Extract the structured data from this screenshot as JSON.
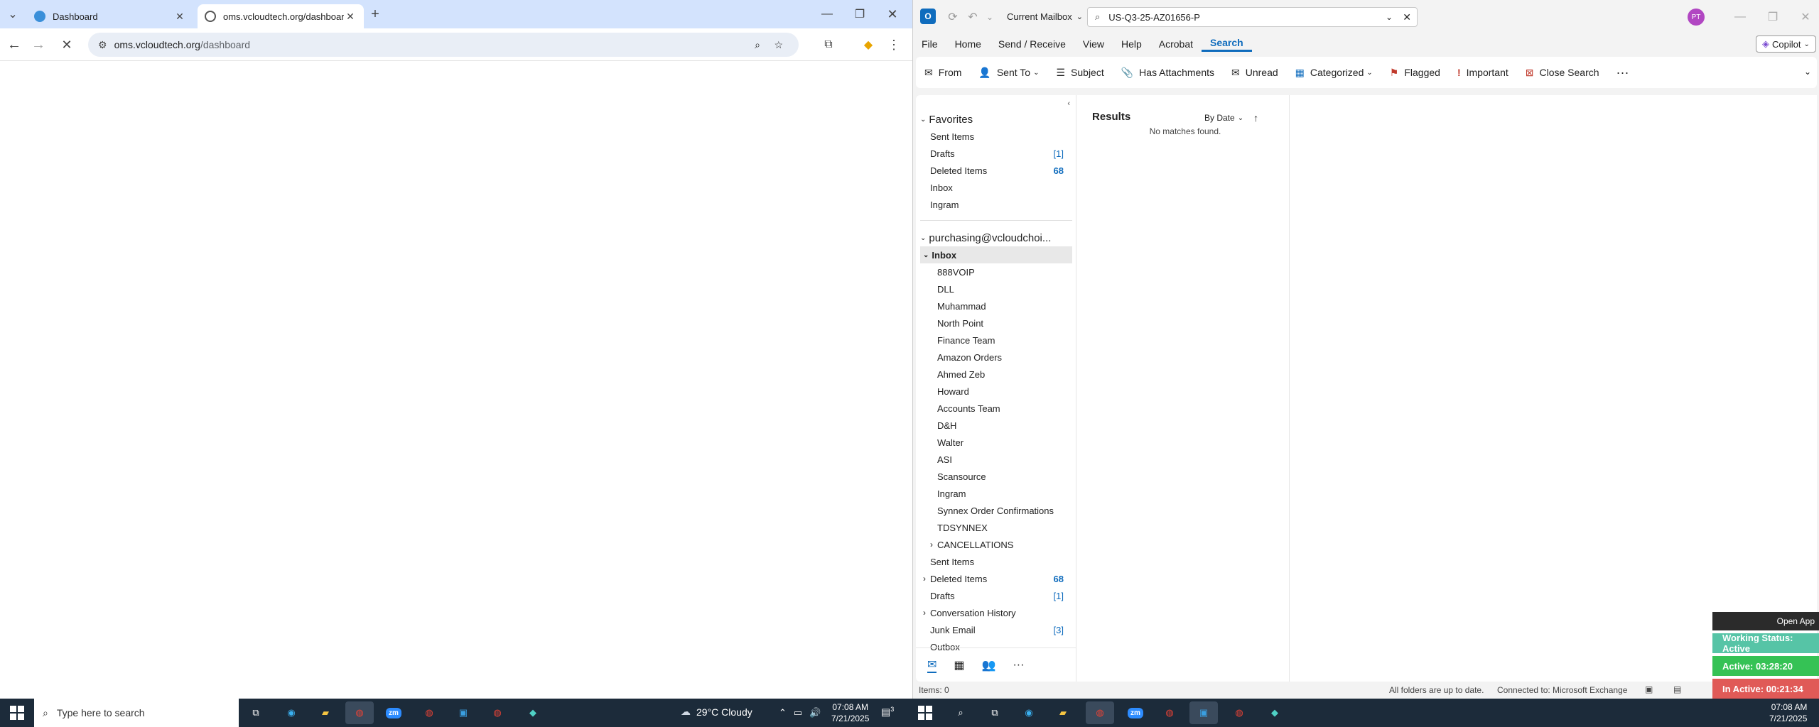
{
  "chrome": {
    "tabs": [
      {
        "title": "Dashboard"
      },
      {
        "title": "oms.vcloudtech.org/dashboard"
      }
    ],
    "url_host": "oms.vcloudtech.org",
    "url_path": "/dashboard"
  },
  "outlook": {
    "scope": "Current Mailbox",
    "search_query": "US-Q3-25-AZ01656-P",
    "avatar_initials": "PT",
    "copilot_label": "Copilot",
    "menu": [
      "File",
      "Home",
      "Send / Receive",
      "View",
      "Help",
      "Acrobat",
      "Search"
    ],
    "ribbon": [
      "From",
      "Sent To",
      "Subject",
      "Has Attachments",
      "Unread",
      "Categorized",
      "Flagged",
      "Important",
      "Close Search"
    ],
    "favorites_label": "Favorites",
    "favorites": [
      {
        "label": "Sent Items",
        "count": ""
      },
      {
        "label": "Drafts",
        "count": "[1]"
      },
      {
        "label": "Deleted Items",
        "count": "68"
      },
      {
        "label": "Inbox",
        "count": ""
      },
      {
        "label": "Ingram",
        "count": ""
      }
    ],
    "account": "purchasing@vcloudchoi...",
    "inbox_label": "Inbox",
    "inbox_folders": [
      "888VOIP",
      "DLL",
      "Muhammad",
      "North Point",
      "Finance Team",
      "Amazon Orders",
      "Ahmed Zeb",
      "Howard",
      "Accounts Team",
      "D&H",
      "Walter",
      "ASI",
      "Scansource",
      "Ingram",
      "Synnex Order Confirmations",
      "TDSYNNEX",
      "CANCELLATIONS"
    ],
    "account_folders": [
      {
        "label": "Sent Items",
        "count": ""
      },
      {
        "label": "Deleted Items",
        "count": "68"
      },
      {
        "label": "Drafts",
        "count": "[1]"
      },
      {
        "label": "Conversation History",
        "count": ""
      },
      {
        "label": "Junk Email",
        "count": "[3]"
      },
      {
        "label": "Outbox",
        "count": ""
      }
    ],
    "results_label": "Results",
    "sort_label": "By Date",
    "no_matches": "No matches found.",
    "status_items": "Items: 0",
    "status_sync": "All folders are up to date.",
    "status_conn": "Connected to: Microsoft Exchange"
  },
  "widget": {
    "open_app": "Open App",
    "working": "Working Status: Active",
    "active": "Active: 03:28:20",
    "inactive": "In Active: 00:21:34"
  },
  "taskbar": {
    "search_placeholder": "Type here to search",
    "weather": "29°C  Cloudy",
    "time": "07:08 AM",
    "date": "7/21/2025",
    "notif_count": "3"
  },
  "colors": {
    "outlook_blue": "#0f6cbd",
    "working_green": "#56c4a6",
    "active_green": "#35c255",
    "inactive_red": "#e05a57"
  }
}
